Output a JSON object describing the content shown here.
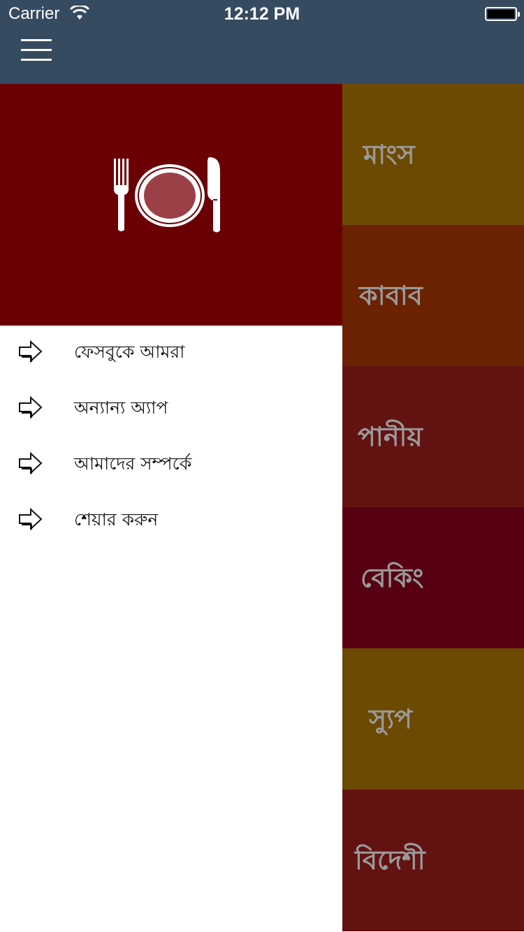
{
  "status_bar": {
    "carrier": "Carrier",
    "time": "12:12 PM"
  },
  "nav": {
    "menu_icon": "hamburger-icon"
  },
  "drawer": {
    "header_icon": "plate-fork-knife-icon",
    "header_color": "#6b0004",
    "items": [
      {
        "label": "ফেসবুকে আমরা",
        "icon": "right-arrow-icon"
      },
      {
        "label": "অন্যান্য অ্যাপ",
        "icon": "right-arrow-icon"
      },
      {
        "label": "আমাদের সম্পর্কে",
        "icon": "right-arrow-icon"
      },
      {
        "label": "শেয়ার করুন",
        "icon": "right-arrow-icon"
      }
    ]
  },
  "categories": [
    {
      "label": "মাংস",
      "color": "#6c4a02"
    },
    {
      "label": "কাবাব",
      "color": "#6a2202"
    },
    {
      "label": "পানীয়",
      "color": "#631212"
    },
    {
      "label": "বেকিং",
      "color": "#560012"
    },
    {
      "label": "স্যুপ",
      "color": "#6c4a02"
    },
    {
      "label": "বিদেশী",
      "color": "#631212"
    }
  ],
  "colors": {
    "nav_bar": "#364a60",
    "tile_text": "#9a9a9a"
  }
}
